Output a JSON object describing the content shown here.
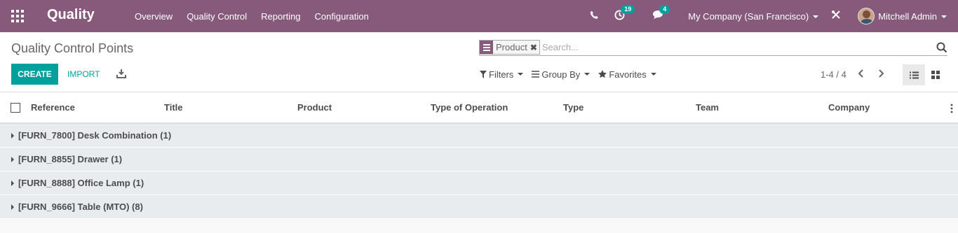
{
  "navbar": {
    "brand": "Quality",
    "menu": [
      "Overview",
      "Quality Control",
      "Reporting",
      "Configuration"
    ],
    "activities_badge": "19",
    "messages_badge": "4",
    "company": "My Company (San Francisco)",
    "user": "Mitchell Admin",
    "color": "#875a7b"
  },
  "control_panel": {
    "title": "Quality Control Points",
    "search": {
      "facet_value": "Product",
      "facet_remove": "✖",
      "placeholder": "Search..."
    },
    "create_label": "CREATE",
    "import_label": "IMPORT",
    "filters_label": "Filters",
    "groupby_label": "Group By",
    "favorites_label": "Favorites",
    "pager": "1-4 / 4",
    "accent": "#00a09d"
  },
  "table": {
    "columns": [
      "Reference",
      "Title",
      "Product",
      "Type of Operation",
      "Type",
      "Team",
      "Company"
    ],
    "groups": [
      "[FURN_7800] Desk Combination (1)",
      "[FURN_8855] Drawer (1)",
      "[FURN_8888] Office Lamp (1)",
      "[FURN_9666] Table (MTO) (8)"
    ]
  }
}
